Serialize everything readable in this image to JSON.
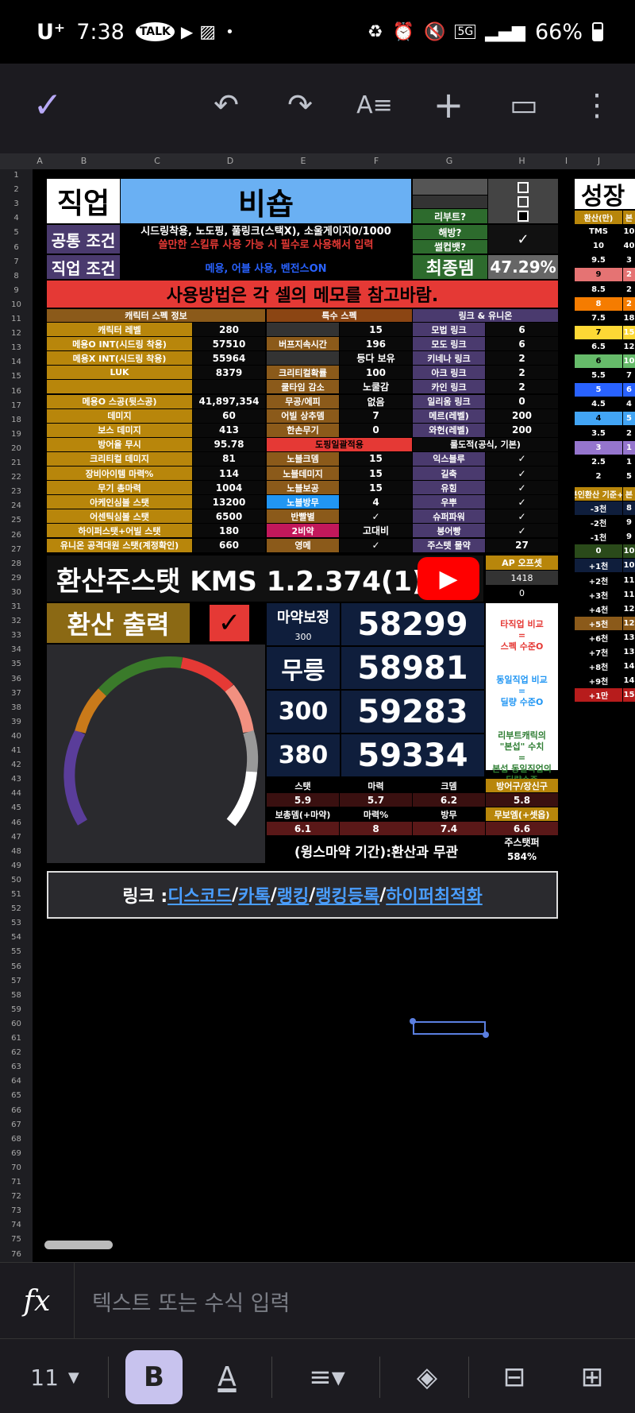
{
  "status_bar": {
    "carrier": "U⁺",
    "time": "7:38",
    "battery": "66%",
    "network": "5G"
  },
  "toolbar": {
    "done": "✓",
    "undo": "↶",
    "redo": "↷",
    "format": "A≡",
    "add": "+",
    "comment": "▭",
    "more": "⋮"
  },
  "sheet": {
    "columns": [
      "A",
      "B",
      "C",
      "D",
      "E",
      "F",
      "G",
      "H",
      "I",
      "J"
    ],
    "rows": [
      "1",
      "2",
      "3",
      "4",
      "5",
      "6",
      "7",
      "8",
      "9",
      "10",
      "11",
      "12",
      "13",
      "14",
      "15",
      "16",
      "17",
      "18",
      "19",
      "20",
      "21",
      "22",
      "23",
      "24",
      "25",
      "26",
      "27",
      "28",
      "29",
      "30",
      "31",
      "32",
      "33",
      "34",
      "35",
      "36",
      "37",
      "38",
      "39",
      "40",
      "41",
      "42",
      "43",
      "44",
      "45",
      "46",
      "47",
      "48",
      "49",
      "50",
      "51",
      "52",
      "53",
      "54",
      "55",
      "56",
      "57",
      "58",
      "59",
      "60",
      "61",
      "62",
      "63",
      "64",
      "65",
      "66",
      "67",
      "68",
      "69",
      "70",
      "71",
      "72",
      "73",
      "74",
      "75",
      "76"
    ],
    "job_label": "직업",
    "job_value": "비숍",
    "common_label": "공통 조건",
    "common_text1": "시드링착용, 노도핑, 풀링크(스택X), 소울게이지0/1000",
    "common_text2": "쓸만한 스킬류 사용 가능 시 필수로 사용해서 입력",
    "job_cond_label": "직업 조건",
    "job_cond_text": "메용, 어블 사용, 벤전스ON",
    "reboot_label": "리부트?",
    "liberated_label": "해방?",
    "sulbaek_label": "썰컵뱃?",
    "final_label": "최종뎀",
    "final_value": "47.29%",
    "usage_note": "사용방법은 각 셀의 메모를 참고바람.",
    "growth_label": "성장",
    "char_header": "캐릭터 스펙 정보",
    "special_header": "특수 스펙",
    "link_header": "링크 & 유니온",
    "char_rows": [
      {
        "l": "캐릭터 레벨",
        "v": "280"
      },
      {
        "l": "메용O INT(시드링 착용)",
        "v": "57510"
      },
      {
        "l": "메용X INT(시드링 착용)",
        "v": "55964"
      },
      {
        "l": "LUK",
        "v": "8379"
      },
      {
        "l": "",
        "v": ""
      },
      {
        "l": "메용O 스공(뒷스공)",
        "v": "41,897,354"
      },
      {
        "l": "데미지",
        "v": "60"
      },
      {
        "l": "보스 데미지",
        "v": "413"
      },
      {
        "l": "방어율 무시",
        "v": "95.78"
      },
      {
        "l": "크리티컬 데미지",
        "v": "81"
      },
      {
        "l": "장비아이템 마력%",
        "v": "114"
      },
      {
        "l": "무기 총마력",
        "v": "1004"
      },
      {
        "l": "아케인심볼 스탯",
        "v": "13200"
      },
      {
        "l": "어센틱심볼 스탯",
        "v": "6500"
      },
      {
        "l": "하이퍼스탯+어빌 스탯",
        "v": "180"
      },
      {
        "l": "유니온 공격대원 스탯(계정확인)",
        "v": "660"
      }
    ],
    "special_rows": [
      {
        "l": "",
        "v": "15"
      },
      {
        "l": "버프지속시간",
        "v": "196"
      },
      {
        "l": "",
        "v": "등다 보유"
      },
      {
        "l": "크리티컬확률",
        "v": "100"
      },
      {
        "l": "쿨타임 감소",
        "v": "노쿨감"
      },
      {
        "l": "무공/에피",
        "v": "없음"
      },
      {
        "l": "어빌 상추뎀",
        "v": "7"
      },
      {
        "l": "한손무기",
        "v": "0"
      },
      {
        "l": "도핑일괄적용",
        "v": ""
      },
      {
        "l": "노블크뎀",
        "v": "15"
      },
      {
        "l": "노블데미지",
        "v": "15"
      },
      {
        "l": "노블보공",
        "v": "15"
      },
      {
        "l": "노블방무",
        "v": "4"
      },
      {
        "l": "반빨별",
        "v": "✓"
      },
      {
        "l": "2비약",
        "v": "고대비"
      },
      {
        "l": "영메",
        "v": "✓"
      }
    ],
    "link_rows": [
      {
        "l": "모법 링크",
        "v": "6"
      },
      {
        "l": "모도 링크",
        "v": "6"
      },
      {
        "l": "키네나 링크",
        "v": "2"
      },
      {
        "l": "아크 링크",
        "v": "2"
      },
      {
        "l": "카인 링크",
        "v": "2"
      },
      {
        "l": "일리움 링크",
        "v": "0"
      },
      {
        "l": "메르(레벨)",
        "v": "200"
      },
      {
        "l": "와헌(레벨)",
        "v": "200"
      },
      {
        "l": "룰도적(공식, 기본)",
        "v": ""
      },
      {
        "l": "익스블루",
        "v": "✓"
      },
      {
        "l": "길축",
        "v": "✓"
      },
      {
        "l": "유힘",
        "v": "✓"
      },
      {
        "l": "우뿌",
        "v": "✓"
      },
      {
        "l": "슈퍼파워",
        "v": "✓"
      },
      {
        "l": "붕어빵",
        "v": "✓"
      },
      {
        "l": "주스텟 물약",
        "v": "27"
      }
    ],
    "banner_title": "환산주스탯 KMS 1.2.374(1)",
    "ap_offset_label": "AP 오프셋",
    "ap_offset_value": "1418",
    "ap_offset_zero": "0",
    "output_label": "환산 출력",
    "big_scores": [
      {
        "label": "마약보정",
        "sub": "300",
        "value": "58299"
      },
      {
        "label": "무릉",
        "sub": "",
        "value": "58981"
      },
      {
        "label": "300",
        "sub": "",
        "value": "59283"
      },
      {
        "label": "380",
        "sub": "",
        "value": "59334"
      }
    ],
    "note1": "타직업 비교\n=\n스펙 수준O",
    "note2": "동일직업 비교\n=\n딜량 수준O",
    "note3": "리부트캐릭의\n\"본섭\" 수치\n=\n본섭 동일직업의\n딜량수준",
    "stat_headers": [
      "스탯",
      "마력",
      "크뎀",
      "방어구/장신구"
    ],
    "stat_values": [
      "5.9",
      "5.7",
      "6.2",
      "5.8"
    ],
    "stat_headers2": [
      "보총뎀(+마약)",
      "마력%",
      "방무",
      "무보엠(+셋옵)"
    ],
    "stat_values2": [
      "6.1",
      "8",
      "7.4",
      "6.6"
    ],
    "potion_note": "(윙스마약 기간):환산과 무관",
    "main_stat_label": "주스탯퍼",
    "main_stat_value": "584%",
    "links_prefix": "링크 : ",
    "links": [
      "디스코드",
      "카톡",
      "랭킹",
      "랭킹등록",
      "하이퍼최적화"
    ],
    "growth_col": [
      {
        "a": "환산(만)",
        "b": "본"
      },
      {
        "a": "TMS",
        "b": "10"
      },
      {
        "a": "10",
        "b": "40"
      },
      {
        "a": "9.5",
        "b": "3"
      },
      {
        "a": "9",
        "b": "2"
      },
      {
        "a": "8.5",
        "b": "2"
      },
      {
        "a": "8",
        "b": "2"
      },
      {
        "a": "7.5",
        "b": "18"
      },
      {
        "a": "7",
        "b": "15"
      },
      {
        "a": "6.5",
        "b": "12"
      },
      {
        "a": "6",
        "b": "10"
      },
      {
        "a": "5.5",
        "b": "7"
      },
      {
        "a": "5",
        "b": "6"
      },
      {
        "a": "4.5",
        "b": "4"
      },
      {
        "a": "4",
        "b": "5"
      },
      {
        "a": "3.5",
        "b": "2"
      },
      {
        "a": "3",
        "b": "1"
      },
      {
        "a": "2.5",
        "b": "1"
      },
      {
        "a": "2",
        "b": "5"
      },
      {
        "a": "본인환산 기준+-",
        "b": "본"
      },
      {
        "a": "-3천",
        "b": "8"
      },
      {
        "a": "-2천",
        "b": "9"
      },
      {
        "a": "-1천",
        "b": "9"
      },
      {
        "a": "0",
        "b": "10"
      },
      {
        "a": "+1천",
        "b": "10"
      },
      {
        "a": "+2천",
        "b": "11"
      },
      {
        "a": "+3천",
        "b": "11"
      },
      {
        "a": "+4천",
        "b": "12"
      },
      {
        "a": "+5천",
        "b": "12"
      },
      {
        "a": "+6천",
        "b": "13"
      },
      {
        "a": "+7천",
        "b": "13"
      },
      {
        "a": "+8천",
        "b": "14"
      },
      {
        "a": "+9천",
        "b": "14"
      },
      {
        "a": "+1만",
        "b": "15"
      }
    ]
  },
  "formula_bar": {
    "fx": "fx",
    "placeholder": "텍스트 또는 수식 입력"
  },
  "bottom_bar": {
    "font_size": "11",
    "bold": "B",
    "text_color": "A"
  }
}
